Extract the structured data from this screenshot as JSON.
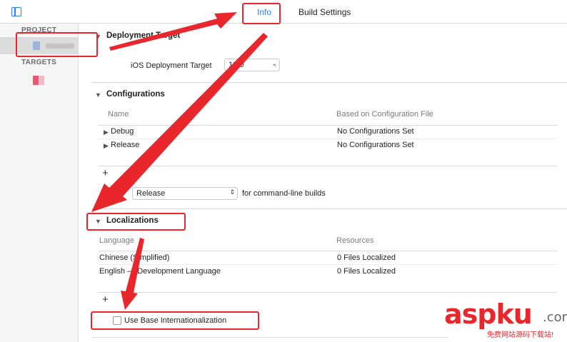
{
  "tabs": [
    {
      "label": "Info",
      "selected": true
    },
    {
      "label": "Build Settings",
      "selected": false
    }
  ],
  "sidebar": {
    "project_header": "PROJECT",
    "targets_header": "TARGETS"
  },
  "deployment": {
    "title": "Deployment Target",
    "target_label": "iOS Deployment Target",
    "target_value": "10.0"
  },
  "configurations": {
    "title": "Configurations",
    "col_name": "Name",
    "col_based_on": "Based on Configuration File",
    "rows": [
      {
        "name": "Debug",
        "based_on": "No Configurations Set"
      },
      {
        "name": "Release",
        "based_on": "No Configurations Set"
      }
    ],
    "add_symbol": "+",
    "use_prefix": "Use",
    "use_value": "Release",
    "use_suffix": "for command-line builds"
  },
  "localizations": {
    "title": "Localizations",
    "col_language": "Language",
    "col_resources": "Resources",
    "rows": [
      {
        "language": "Chinese (Simplified)",
        "resources": "0 Files Localized"
      },
      {
        "language": "English — Development Language",
        "resources": "0 Files Localized"
      }
    ],
    "add_symbol": "+",
    "base_intl_label": "Use Base Internationalization",
    "base_intl_checked": false
  },
  "watermark": {
    "main": "aspku",
    "domain": ".com",
    "sub": "免费网站源码下载站!"
  },
  "colors": {
    "accent": "#2d7ff9",
    "annotation_red": "#e8262c"
  }
}
